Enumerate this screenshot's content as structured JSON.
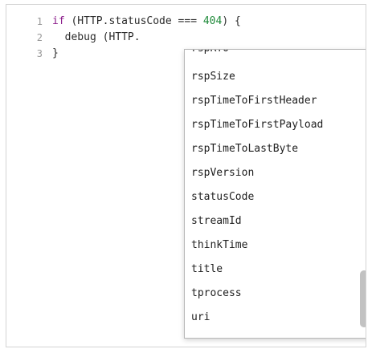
{
  "editor": {
    "line_numbers": [
      "1",
      "2",
      "3"
    ],
    "lines": [
      {
        "tokens": [
          {
            "text": "if",
            "kind": "keyword"
          },
          {
            "text": " (HTTP.statusCode === ",
            "kind": "plain"
          },
          {
            "text": "404",
            "kind": "number"
          },
          {
            "text": ") {",
            "kind": "plain"
          }
        ]
      },
      {
        "tokens": [
          {
            "text": "  debug (HTTP.",
            "kind": "plain"
          }
        ]
      },
      {
        "tokens": [
          {
            "text": "}",
            "kind": "plain"
          }
        ]
      }
    ],
    "colors": {
      "keyword": "#8a1a8a",
      "number": "#1f8a3a",
      "text": "#2b2b2b",
      "gutter_text": "#9a9a9a"
    }
  },
  "autocomplete": {
    "partial_item": "rspRTO",
    "items": [
      "rspSize",
      "rspTimeToFirstHeader",
      "rspTimeToFirstPayload",
      "rspTimeToLastByte",
      "rspVersion",
      "statusCode",
      "streamId",
      "thinkTime",
      "title",
      "tprocess",
      "uri"
    ]
  }
}
